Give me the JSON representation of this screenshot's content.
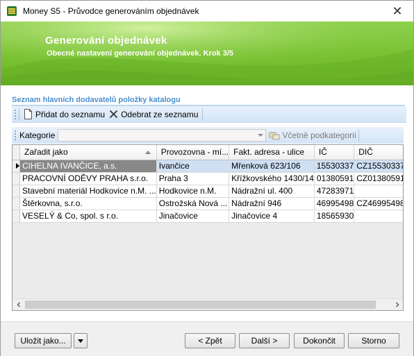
{
  "window": {
    "title": "Money S5 - Průvodce generováním objednávek",
    "close_glyph": "✕"
  },
  "banner": {
    "title": "Generování objednávek",
    "subtitle": "Obecné nastavení generování objednávek. Krok 3/5"
  },
  "section": {
    "title": "Seznam hlavních dodavatelů položky katalogu"
  },
  "toolbar": {
    "add_label": "Přidat do seznamu",
    "remove_label": "Odebrat ze seznamu"
  },
  "filter": {
    "category_label": "Kategorie",
    "category_value": "",
    "include_sub_label": "Včetně podkategorií"
  },
  "grid": {
    "columns": [
      "Zařadit jako",
      "Provozovna - mí...",
      "Fakt. adresa - ulice",
      "IČ",
      "DIČ"
    ],
    "rows": [
      [
        "CIHELNA IVANČICE, a.s.",
        "Ivančice",
        "Mřenková 623/106",
        "15530337",
        "CZ15530337"
      ],
      [
        "PRACOVNÍ ODĚVY PRAHA s.r.o.",
        "Praha 3",
        "Křížkovského 1430/14",
        "01380591",
        "CZ01380591"
      ],
      [
        "Stavební materiál Hodkovice n.M. ...",
        "Hodkovice n.M.",
        "Nádražní ul. 400",
        "47283971",
        ""
      ],
      [
        "Štěrkovna, s.r.o.",
        "Ostrožská Nová ...",
        "Nádražní 946",
        "46995498",
        "CZ46995498"
      ],
      [
        "VESELÝ & Co, spol. s r.o.",
        "Jinačovice",
        "Jinačovice 4",
        "18565930",
        ""
      ]
    ],
    "selected_row": 0
  },
  "buttons": {
    "save_as": "Uložit jako...",
    "back": "< Zpět",
    "next": "Další >",
    "finish": "Dokončit",
    "cancel": "Storno"
  },
  "colors": {
    "banner_green": "#78c131",
    "section_title": "#4a8fd0",
    "selection": "#cfe0f3"
  }
}
